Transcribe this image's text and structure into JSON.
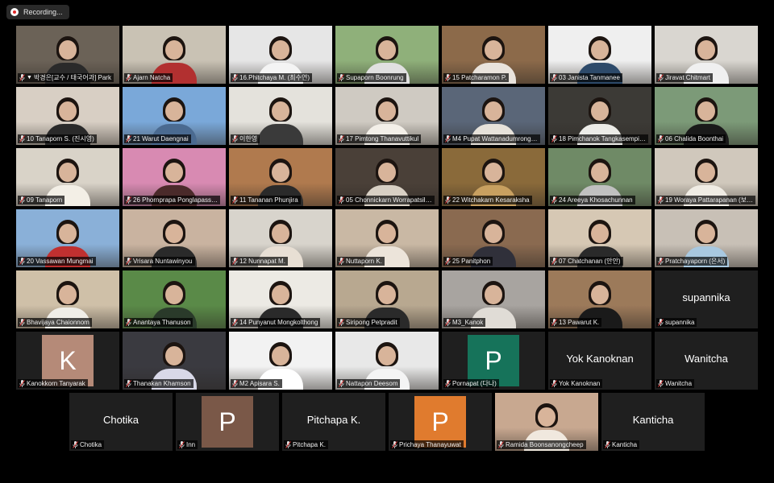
{
  "recording": {
    "label": "Recording..."
  },
  "rows": [
    [
      {
        "name": "박경은[교수 / 태국어과] Park",
        "pinned": true,
        "active": true,
        "bg": "#6b6257",
        "shirt": "#2a2a2a"
      },
      {
        "name": "Ajarn Natcha",
        "bg": "#c9c2b4",
        "shirt": "#b23030"
      },
      {
        "name": "16.Phitchaya M. (최수연)",
        "bg": "#e6e6e6",
        "shirt": "#f4f4f4"
      },
      {
        "name": "Supaporn Boonrung",
        "bg": "#8fb07a",
        "shirt": "#e0e0e0"
      },
      {
        "name": "15 Patcharamon P.",
        "bg": "#8c6a4a",
        "shirt": "#e9e3dc"
      },
      {
        "name": "03 Janista Tanmanee",
        "bg": "#efefef",
        "shirt": "#2d4a6a"
      },
      {
        "name": "Jiravat Chitmart",
        "bg": "#d9d6d0",
        "shirt": "#f0f0f0"
      }
    ],
    [
      {
        "name": "10 Tanaporn S. (진시영)",
        "bg": "#d8cfc4",
        "shirt": "#2a2a2a"
      },
      {
        "name": "21 Warut Daengnai",
        "bg": "#7aa8d9",
        "shirt": "#4a6a90"
      },
      {
        "name": "이한영",
        "bg": "#e4e2dc",
        "shirt": "#3a3a3a"
      },
      {
        "name": "17 Pimtong Thanavuttikul",
        "bg": "#cfcac2",
        "shirt": "#f3efe8"
      },
      {
        "name": "M4 Pupat Wattanadumrong…",
        "bg": "#5a6678",
        "shirt": "#e7e2da"
      },
      {
        "name": "18 Pimchanok Tangkasempi…",
        "bg": "#3c3a36",
        "shirt": "#ecece8"
      },
      {
        "name": "06 Chalida Boonthai",
        "bg": "#7c9a78",
        "shirt": "#1a1a1a"
      }
    ],
    [
      {
        "name": "09 Tanaporn",
        "bg": "#d9d3c8",
        "shirt": "#f3efe6"
      },
      {
        "name": "26 Phornprapa Ponglapass…",
        "bg": "#d88ab2",
        "shirt": "#4a2a2a"
      },
      {
        "name": "11 Tananan Phunjira",
        "bg": "#b07a4e",
        "shirt": "#2a2a2a"
      },
      {
        "name": "05 Chonnickarn Worrapatsil…",
        "bg": "#4a4038",
        "shirt": "#d8d0c4"
      },
      {
        "name": "22 Witchakarn Kesaraksha",
        "bg": "#8a6a3a",
        "shirt": "#c8a060"
      },
      {
        "name": "24 Areeya Khosachunnan",
        "bg": "#6f8a66",
        "shirt": "#c0c0c0"
      },
      {
        "name": "19 Woraya Pattarapanan (보…",
        "bg": "#d0c8bc",
        "shirt": "#f0ece4"
      }
    ],
    [
      {
        "name": "20 Vassawan Mungmai",
        "bg": "#8ab0d8",
        "shirt": "#c03030"
      },
      {
        "name": "Vrisara Nuntawinyou",
        "bg": "#c9b3a0",
        "shirt": "#2a2a2a"
      },
      {
        "name": "12 Nunnapat M.",
        "bg": "#d8d4cc",
        "shirt": "#e8dfd4"
      },
      {
        "name": "Nuttaporn K.",
        "bg": "#c9b8a4",
        "shirt": "#ece4da"
      },
      {
        "name": "25 Panitphon",
        "bg": "#8a6a50",
        "shirt": "#30303a"
      },
      {
        "name": "07 Chatchanan (안안)",
        "bg": "#d6c8b4",
        "shirt": "#2a2a2a"
      },
      {
        "name": "Pratchayaporn (은서)",
        "bg": "#c8c0b6",
        "shirt": "#a8c8e0"
      }
    ],
    [
      {
        "name": "Bhavijaya Chaionnom",
        "bg": "#cfc0a8",
        "shirt": "#f0eee8"
      },
      {
        "name": "Anantaya Thanuson",
        "bg": "#5a8a48",
        "shirt": "#2a3a2a"
      },
      {
        "name": "14 Punyanut Mongkolthong",
        "bg": "#eceae4",
        "shirt": "#2a2a2a"
      },
      {
        "name": "Siripong Petpradit",
        "bg": "#b8a890",
        "shirt": "#2a2a2a"
      },
      {
        "name": "M3_Kanok",
        "bg": "#a8a4a0",
        "shirt": "#e0dcd6"
      },
      {
        "name": "13 Pawarut K.",
        "bg": "#9c7a5a",
        "shirt": "#1a1a1a"
      },
      {
        "name": "supannika",
        "card": "supannika"
      }
    ],
    [
      {
        "name": "Kanokkorn Tanyarak",
        "avatar": "K",
        "avatar_color": "#b58a78"
      },
      {
        "name": "Thanakan Khamson",
        "bg": "#3a3a40",
        "shirt": "#d8d8e8"
      },
      {
        "name": "M2 Apisara S.",
        "bg": "#f2f2f2",
        "shirt": "#ffffff"
      },
      {
        "name": "Nattapon Deesom",
        "bg": "#e8e8e8",
        "shirt": "#f4f4f4"
      },
      {
        "name": "Pornapat (다나)",
        "avatar": "P",
        "avatar_color": "#16735a"
      },
      {
        "name": "Yok Kanoknan",
        "card": "Yok Kanoknan"
      },
      {
        "name": "Wanitcha",
        "card": "Wanitcha"
      }
    ],
    [
      {
        "name": "Chotika",
        "card": "Chotika"
      },
      {
        "name": "Inn",
        "avatar": "P",
        "avatar_color": "#7a5848"
      },
      {
        "name": "Pitchapa K.",
        "card": "Pitchapa K."
      },
      {
        "name": "Prichaya Thanayuwat",
        "avatar": "P",
        "avatar_color": "#e07b2e"
      },
      {
        "name": "Ramida Boonsanongcheep",
        "bg": "#c8a890",
        "shirt": "#f0e8de"
      },
      {
        "name": "Kanticha",
        "card": "Kanticha"
      }
    ]
  ]
}
